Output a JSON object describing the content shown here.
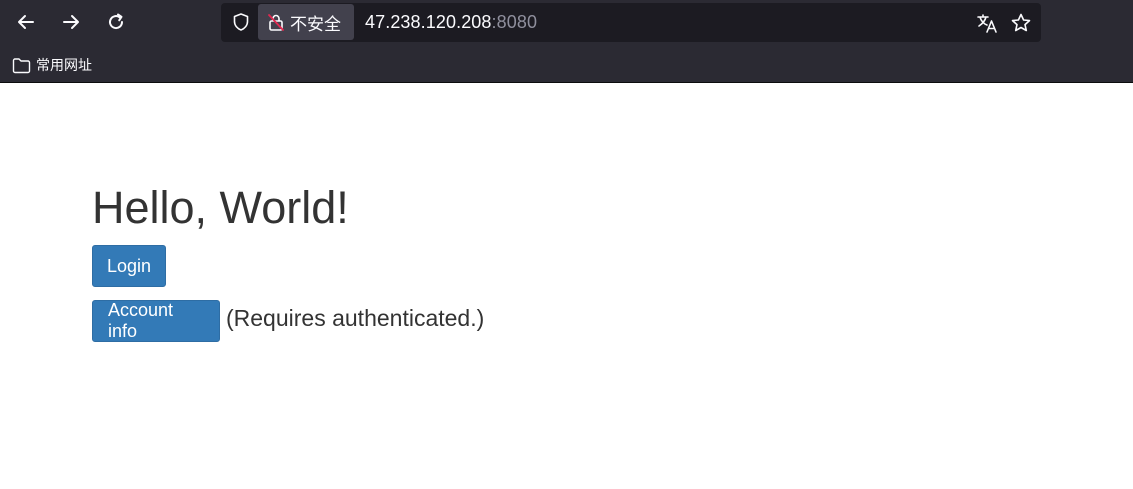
{
  "browser": {
    "security_label": "不安全",
    "url_host": "47.238.120.208",
    "url_port": ":8080",
    "bookmark_folder": "常用网址"
  },
  "page": {
    "title": "Hello, World!",
    "login_label": "Login",
    "account_label": "Account info",
    "note": "(Requires authenticated.)"
  },
  "colors": {
    "primary_button": "#337ab7",
    "chrome_bg": "#2b2a33"
  }
}
